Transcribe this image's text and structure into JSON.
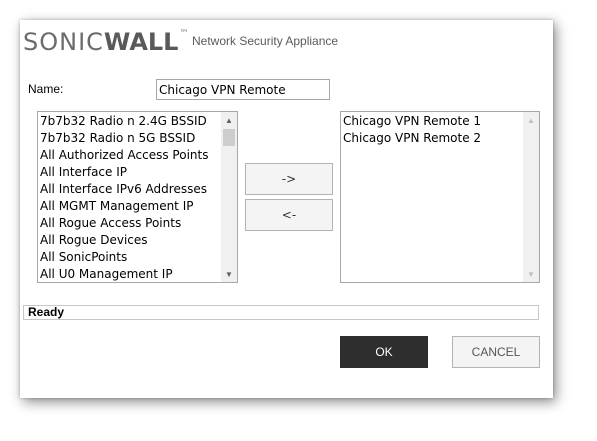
{
  "header": {
    "brand_light": "SONIC",
    "brand_bold": "WALL",
    "trademark": "™",
    "product": "Network Security Appliance"
  },
  "form": {
    "name_label": "Name:",
    "name_value": "Chicago VPN Remote"
  },
  "available_list": {
    "items": [
      "7b7b32 Radio n 2.4G BSSID",
      "7b7b32 Radio n 5G BSSID",
      "All Authorized Access Points",
      "All Interface IP",
      "All Interface IPv6 Addresses",
      "All MGMT Management IP",
      "All Rogue Access Points",
      "All Rogue Devices",
      "All SonicPoints",
      "All U0 Management IP"
    ]
  },
  "selected_list": {
    "items": [
      "Chicago VPN Remote 1",
      "Chicago VPN Remote 2"
    ]
  },
  "move": {
    "add_label": "->",
    "remove_label": "<-"
  },
  "status": {
    "text": "Ready"
  },
  "buttons": {
    "ok_label": "OK",
    "cancel_label": "CANCEL"
  },
  "colors": {
    "ok_bg": "#2e2e2e",
    "border": "#a7a7a7",
    "brand_text": "#6b6b6b"
  }
}
